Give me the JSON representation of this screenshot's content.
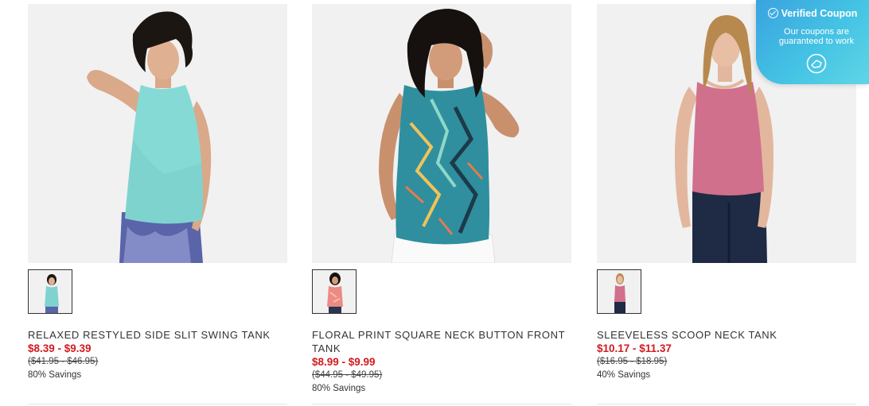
{
  "products": [
    {
      "title": "RELAXED RESTYLED SIDE SLIT SWING TANK",
      "sale_price": "$8.39 - $9.39",
      "original_price": "($41.95 - $46.95)",
      "savings": "80% Savings",
      "image": "teal-tank-model-photo",
      "thumbnail": "teal-tank-thumbnail"
    },
    {
      "title": "FLORAL PRINT SQUARE NECK BUTTON FRONT TANK",
      "sale_price": "$8.99 - $9.99",
      "original_price": "($44.95 - $49.95)",
      "savings": "80% Savings",
      "image": "floral-tank-model-photo",
      "thumbnail": "coral-tank-thumbnail"
    },
    {
      "title": "SLEEVELESS SCOOP NECK TANK",
      "sale_price": "$10.17 - $11.37",
      "original_price": "($16.95 - $18.95)",
      "savings": "40% Savings",
      "image": "pink-tank-model-photo",
      "thumbnail": "pink-tank-thumbnail"
    }
  ],
  "coupon_badge": {
    "title": "Verified Coupon",
    "subtitle": "Our coupons are guaranteed to work",
    "icon": "coupon-logo-icon",
    "gradient_start": "#3aa3e0",
    "gradient_end": "#5fd6e6"
  },
  "colors": {
    "sale_price": "#d21a1f",
    "text": "#333333",
    "photo_background": "#f1f1f1"
  }
}
